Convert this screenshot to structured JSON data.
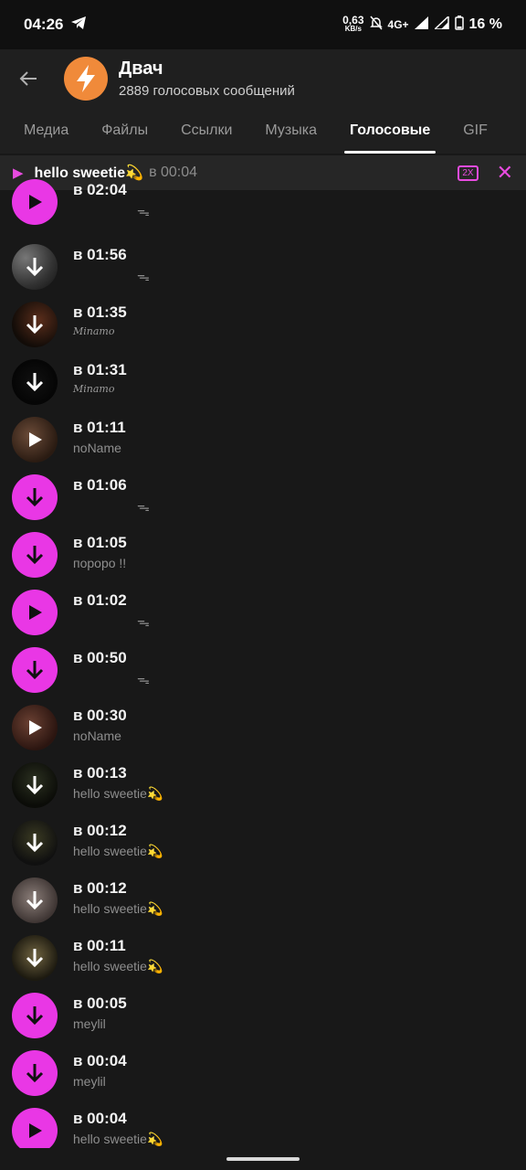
{
  "status": {
    "time": "04:26",
    "speed_value": "0,63",
    "speed_unit": "KB/s",
    "network": "4G+",
    "battery": "16 %"
  },
  "header": {
    "title": "Двач",
    "subtitle": "2889 голосовых сообщений"
  },
  "tabs": [
    "Медиа",
    "Файлы",
    "Ссылки",
    "Музыка",
    "Голосовые",
    "GIF"
  ],
  "player": {
    "title": "hello sweetie💫",
    "time": "в 00:04",
    "speed": "2X"
  },
  "items": [
    {
      "time": "в 02:04",
      "sender": "ᯓ"
    },
    {
      "time": "в 01:56",
      "sender": "ᯓ"
    },
    {
      "time": "в 01:35",
      "sender": "Minamo"
    },
    {
      "time": "в 01:31",
      "sender": "Minamo"
    },
    {
      "time": "в 01:11",
      "sender": "noName"
    },
    {
      "time": "в 01:06",
      "sender": "ᯓ"
    },
    {
      "time": "в 01:05",
      "sender": "пороро !!"
    },
    {
      "time": "в 01:02",
      "sender": "ᯓ"
    },
    {
      "time": "в 00:50",
      "sender": "ᯓ"
    },
    {
      "time": "в 00:30",
      "sender": "noName"
    },
    {
      "time": "в 00:13",
      "sender": "hello sweetie💫"
    },
    {
      "time": "в 00:12",
      "sender": "hello sweetie💫"
    },
    {
      "time": "в 00:12",
      "sender": "hello sweetie💫"
    },
    {
      "time": "в 00:11",
      "sender": "hello sweetie💫"
    },
    {
      "time": "в 00:05",
      "sender": "meylil"
    },
    {
      "time": "в 00:04",
      "sender": "meylil"
    },
    {
      "time": "в 00:04",
      "sender": "hello sweetie💫"
    }
  ],
  "colors": {
    "accent": "#e937e5",
    "background": "#181818",
    "header": "#1f1f1f"
  }
}
